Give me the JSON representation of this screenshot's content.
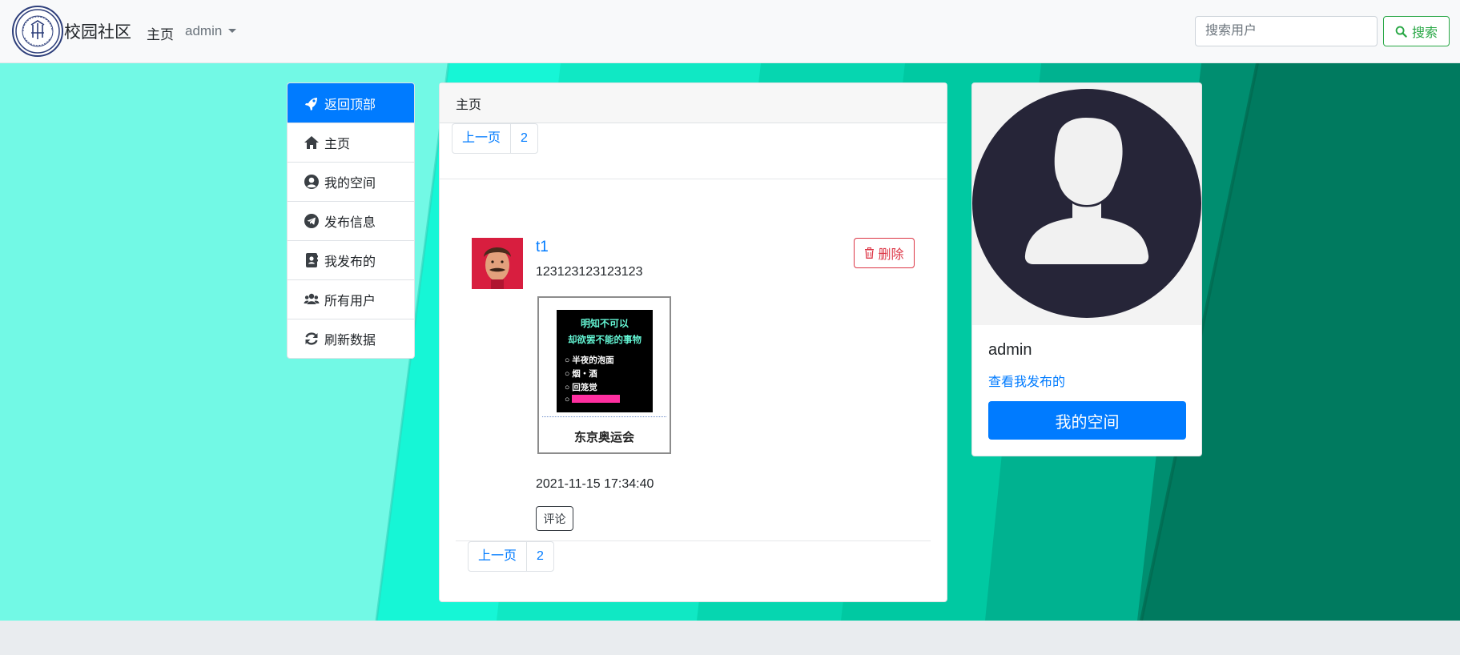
{
  "navbar": {
    "brand": "校园社区",
    "home_label": "主页",
    "user_menu_label": "admin",
    "search_placeholder": "搜索用户",
    "search_button_label": "搜索"
  },
  "sidebar": {
    "items": [
      {
        "label": "返回顶部",
        "icon": "rocket-icon",
        "active": true
      },
      {
        "label": "主页",
        "icon": "home-icon"
      },
      {
        "label": "我的空间",
        "icon": "user-circle-icon"
      },
      {
        "label": "发布信息",
        "icon": "telegram-icon"
      },
      {
        "label": "我发布的",
        "icon": "address-book-icon"
      },
      {
        "label": "所有用户",
        "icon": "users-icon"
      },
      {
        "label": "刷新数据",
        "icon": "refresh-icon"
      }
    ]
  },
  "main": {
    "header": "主页",
    "pagination_top": {
      "prev": "上一页",
      "page": "2"
    },
    "post": {
      "title": "t1",
      "body": "123123123123123",
      "delete_label": "删除",
      "image_lines": [
        "明知不可以",
        "却欲罢不能的事物",
        "半夜的泡面",
        "烟・酒",
        "回笼觉"
      ],
      "image_caption": "东京奥运会",
      "timestamp": "2021-11-15 17:34:40",
      "comment_label": "评论"
    },
    "pagination_bottom": {
      "prev": "上一页",
      "page": "2"
    }
  },
  "profile": {
    "name": "admin",
    "link_label": "查看我发布的",
    "button_label": "我的空间"
  },
  "colors": {
    "primary": "#007bff",
    "success": "#28a745",
    "danger": "#dc3545",
    "bg_light_teal": "#72f9e5",
    "bg_mid_teal": "#12d1b0",
    "bg_dark_teal": "#007a5f"
  }
}
